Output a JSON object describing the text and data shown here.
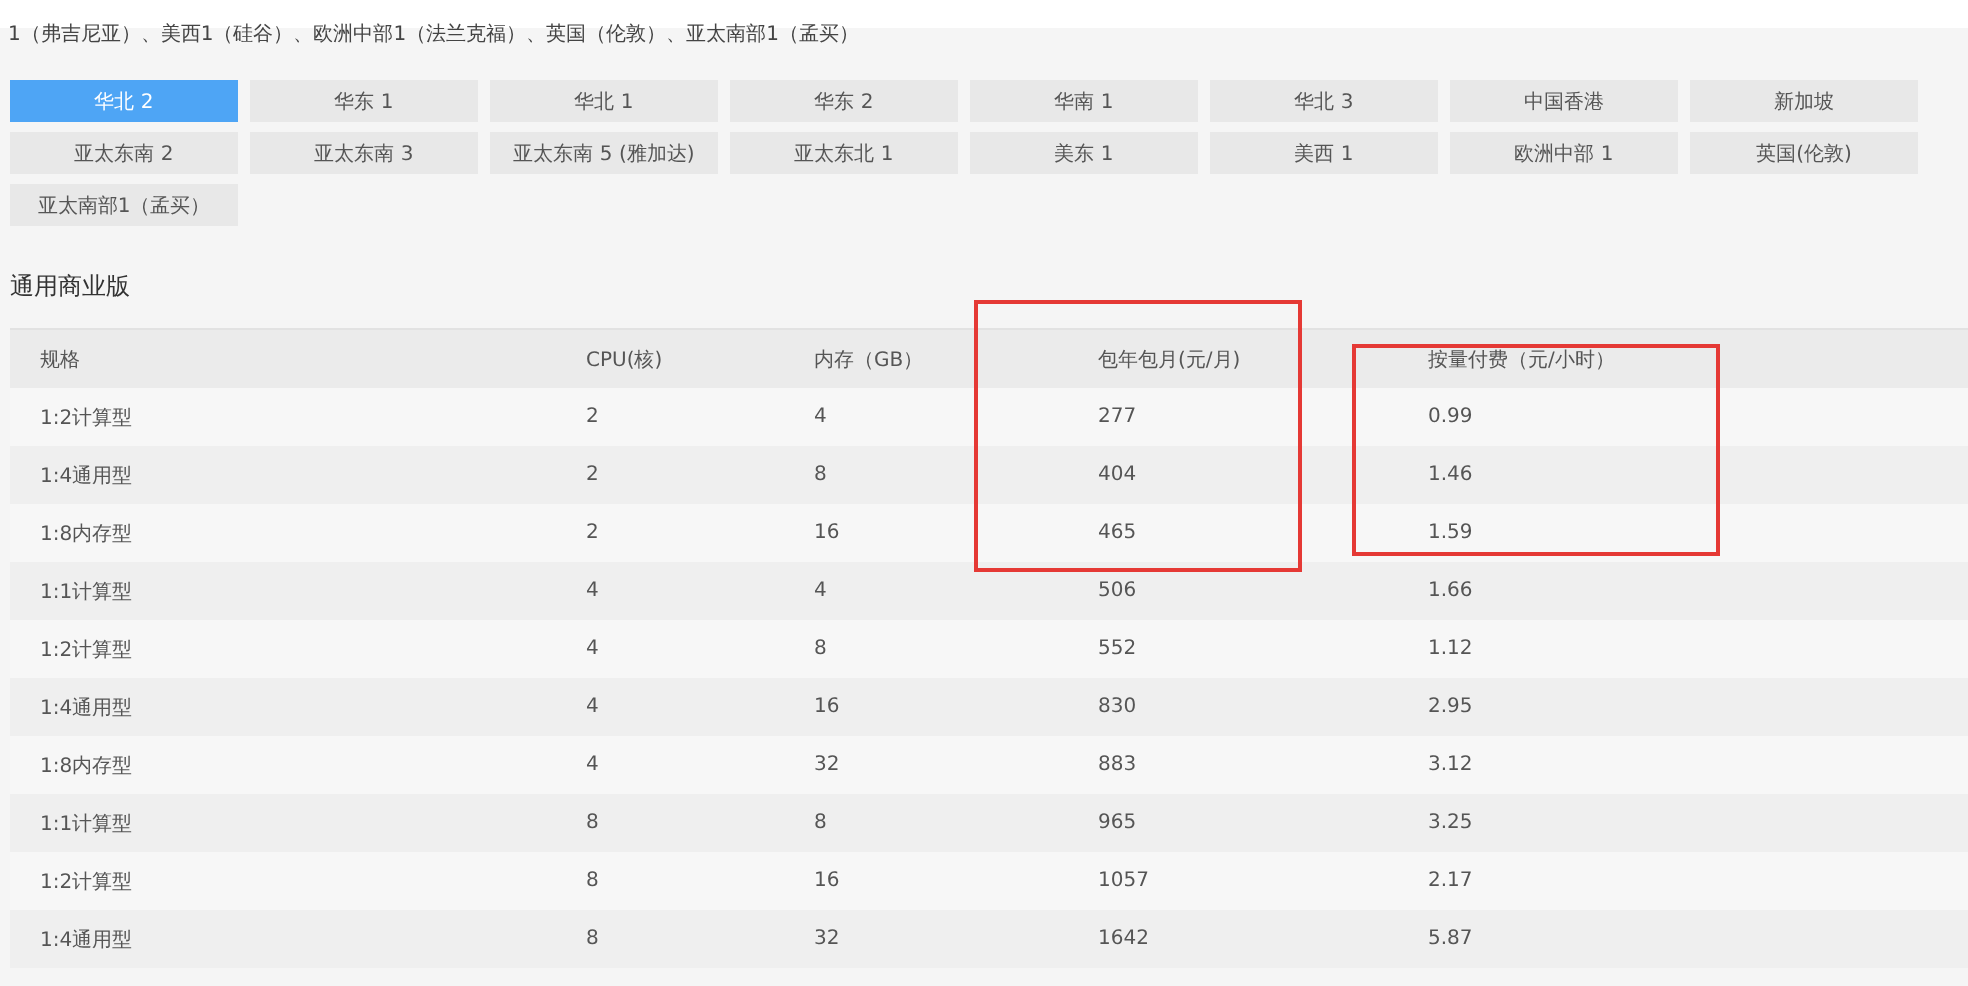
{
  "region_note": "1（弗吉尼亚）、美西1（硅谷）、欧洲中部1（法兰克福）、英国（伦敦）、亚太南部1（孟买）",
  "regions": [
    {
      "label": "华北 2",
      "selected": true
    },
    {
      "label": "华东 1",
      "selected": false
    },
    {
      "label": "华北 1",
      "selected": false
    },
    {
      "label": "华东 2",
      "selected": false
    },
    {
      "label": "华南 1",
      "selected": false
    },
    {
      "label": "华北 3",
      "selected": false
    },
    {
      "label": "中国香港",
      "selected": false
    },
    {
      "label": "新加坡",
      "selected": false
    },
    {
      "label": "亚太东南 2",
      "selected": false
    },
    {
      "label": "亚太东南 3",
      "selected": false
    },
    {
      "label": "亚太东南 5 (雅加达)",
      "selected": false
    },
    {
      "label": "亚太东北 1",
      "selected": false
    },
    {
      "label": "美东 1",
      "selected": false
    },
    {
      "label": "美西 1",
      "selected": false
    },
    {
      "label": "欧洲中部 1",
      "selected": false
    },
    {
      "label": "英国(伦敦)",
      "selected": false
    },
    {
      "label": "亚太南部1（孟买）",
      "selected": false
    }
  ],
  "section_title": "通用商业版",
  "table": {
    "columns": [
      "规格",
      "CPU(核)",
      "内存（GB）",
      "包年包月(元/月)",
      "按量付费（元/小时）"
    ],
    "rows": [
      [
        "1:2计算型",
        "2",
        "4",
        "277",
        "0.99"
      ],
      [
        "1:4通用型",
        "2",
        "8",
        "404",
        "1.46"
      ],
      [
        "1:8内存型",
        "2",
        "16",
        "465",
        "1.59"
      ],
      [
        "1:1计算型",
        "4",
        "4",
        "506",
        "1.66"
      ],
      [
        "1:2计算型",
        "4",
        "8",
        "552",
        "1.12"
      ],
      [
        "1:4通用型",
        "4",
        "16",
        "830",
        "2.95"
      ],
      [
        "1:8内存型",
        "4",
        "32",
        "883",
        "3.12"
      ],
      [
        "1:1计算型",
        "8",
        "8",
        "965",
        "3.25"
      ],
      [
        "1:2计算型",
        "8",
        "16",
        "1057",
        "2.17"
      ],
      [
        "1:4通用型",
        "8",
        "32",
        "1642",
        "5.87"
      ]
    ]
  }
}
